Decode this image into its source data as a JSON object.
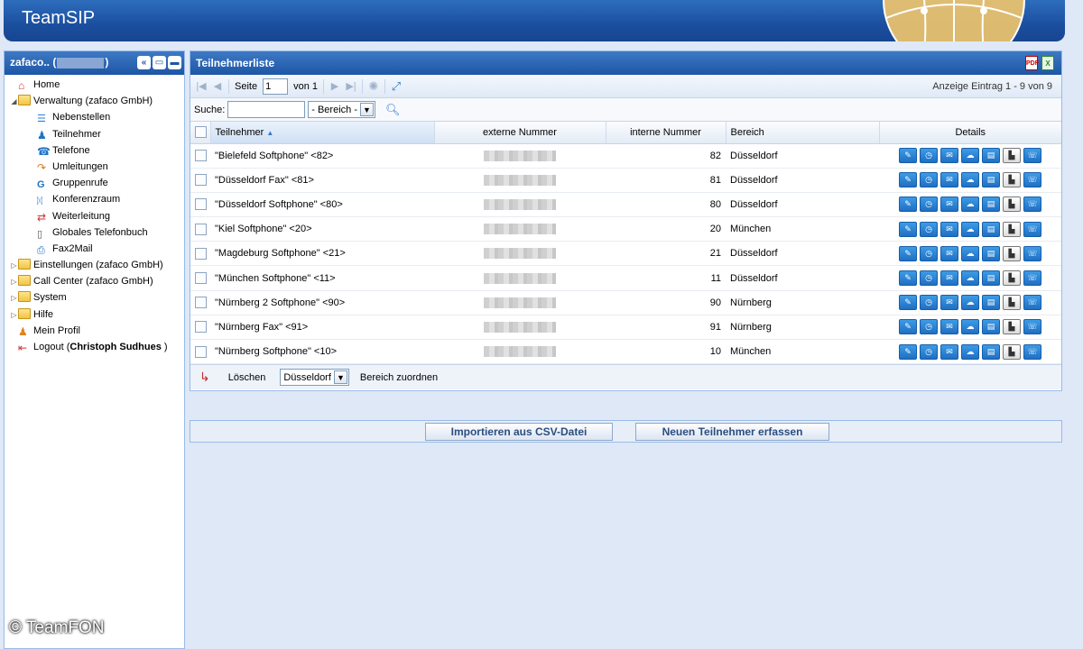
{
  "app": {
    "title": "TeamSIP"
  },
  "sidebar": {
    "user_prefix": "zafaco.. (",
    "user_suffix": ")",
    "tools": [
      "«",
      "▭",
      "▬"
    ],
    "items": [
      {
        "label": "Home",
        "icon": "home-icon",
        "level": 0
      },
      {
        "label": "Verwaltung (zafaco GmbH)",
        "icon": "folder-open-icon",
        "level": 0,
        "expanded": true
      },
      {
        "label": "Nebenstellen",
        "icon": "extensions-icon",
        "level": 1
      },
      {
        "label": "Teilnehmer",
        "icon": "user-icon",
        "level": 1
      },
      {
        "label": "Telefone",
        "icon": "phone-icon",
        "level": 1
      },
      {
        "label": "Umleitungen",
        "icon": "redirect-icon",
        "level": 1
      },
      {
        "label": "Gruppenrufe",
        "icon": "group-call-icon",
        "level": 1
      },
      {
        "label": "Konferenzraum",
        "icon": "conference-icon",
        "level": 1
      },
      {
        "label": "Weiterleitung",
        "icon": "forwarding-icon",
        "level": 1
      },
      {
        "label": "Globales Telefonbuch",
        "icon": "phonebook-icon",
        "level": 1
      },
      {
        "label": "Fax2Mail",
        "icon": "fax-icon",
        "level": 1
      },
      {
        "label": "Einstellungen (zafaco GmbH)",
        "icon": "folder-icon",
        "level": 0
      },
      {
        "label": "Call Center (zafaco GmbH)",
        "icon": "folder-icon",
        "level": 0
      },
      {
        "label": "System",
        "icon": "folder-icon",
        "level": 0
      },
      {
        "label": "Hilfe",
        "icon": "folder-icon",
        "level": 0
      },
      {
        "label": "Mein Profil",
        "icon": "profile-icon",
        "level": 0
      },
      {
        "label": "Logout (",
        "bold": "Christoph Sudhues",
        "suffix": " )",
        "icon": "logout-icon",
        "level": 0
      }
    ]
  },
  "main": {
    "title": "Teilnehmerliste",
    "pager": {
      "page_label": "Seite",
      "page_value": "1",
      "of_label": "von 1",
      "info": "Anzeige Eintrag 1 - 9 von 9"
    },
    "search": {
      "label": "Suche:",
      "value": "",
      "area_select": "- Bereich -"
    },
    "columns": {
      "teilnehmer": "Teilnehmer",
      "extern": "externe Nummer",
      "intern": "interne Nummer",
      "bereich": "Bereich",
      "details": "Details"
    },
    "rows": [
      {
        "name": "\"Bielefeld Softphone\" <82>",
        "intern": "82",
        "bereich": "Düsseldorf"
      },
      {
        "name": "\"Düsseldorf Fax\" <81>",
        "intern": "81",
        "bereich": "Düsseldorf"
      },
      {
        "name": "\"Düsseldorf Softphone\" <80>",
        "intern": "80",
        "bereich": "Düsseldorf"
      },
      {
        "name": "\"Kiel Softphone\" <20>",
        "intern": "20",
        "bereich": "München"
      },
      {
        "name": "\"Magdeburg Softphone\" <21>",
        "intern": "21",
        "bereich": "Düsseldorf"
      },
      {
        "name": "\"München Softphone\" <11>",
        "intern": "11",
        "bereich": "Düsseldorf"
      },
      {
        "name": "\"Nürnberg 2 Softphone\" <90>",
        "intern": "90",
        "bereich": "Nürnberg"
      },
      {
        "name": "\"Nürnberg Fax\" <91>",
        "intern": "91",
        "bereich": "Nürnberg"
      },
      {
        "name": "\"Nürnberg Softphone\" <10>",
        "intern": "10",
        "bereich": "München"
      }
    ],
    "detail_icons": [
      "edit-icon",
      "history-icon",
      "mail-icon",
      "chat-icon",
      "card-icon",
      "pdf-doc-icon",
      "call-icon"
    ],
    "footer": {
      "delete_label": "Löschen",
      "area_value": "Düsseldorf",
      "assign_label": "Bereich zuordnen"
    }
  },
  "actions": {
    "import_label": "Importieren aus CSV-Datei",
    "new_label": "Neuen Teilnehmer erfassen"
  },
  "copyright": "© TeamFON"
}
